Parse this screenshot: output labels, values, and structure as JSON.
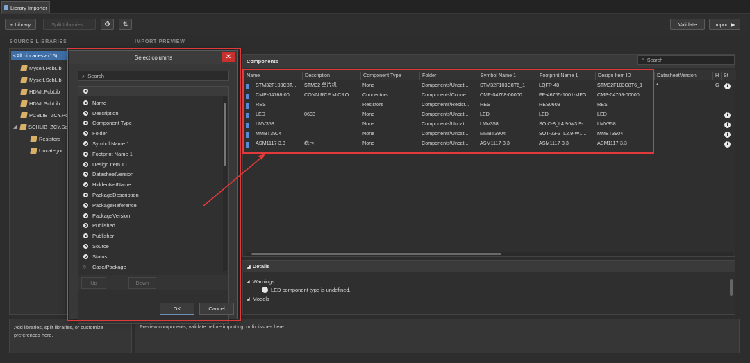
{
  "window": {
    "tab_title": "Library Importer"
  },
  "toolbar": {
    "add_library": "+ Library",
    "split_libraries": "Split Libraries...",
    "validate": "Validate",
    "import": "Import"
  },
  "source_libraries": {
    "title": "SOURCE LIBRARIES",
    "items": [
      {
        "label": "<All Libraries> (16)",
        "selected": true
      },
      {
        "label": "Myself.PcbLib"
      },
      {
        "label": "Myself.SchLib"
      },
      {
        "label": "HDMI.PcbLib"
      },
      {
        "label": "HDMI.SchLib"
      },
      {
        "label": "PCBLIB_ZCY.Pc"
      },
      {
        "label": "SCHLIB_ZCY.Sc"
      },
      {
        "label": "Resistors"
      },
      {
        "label": "Uncategor"
      }
    ]
  },
  "import_preview": {
    "title": "IMPORT PREVIEW",
    "components_label": "Components",
    "search_placeholder": "Search",
    "columns": [
      "Name",
      "Description",
      "Component Type",
      "Folder",
      "Symbol Name 1",
      "Footprint Name 1",
      "Design Item ID",
      "DatasheetVersion",
      "H",
      "St"
    ],
    "rows": [
      [
        "STM32F103C8T...",
        "STM32 单片机",
        "None",
        "Components\\Uncat...",
        "STM32F103C8T6_1",
        "LQFP-48",
        "STM32F103C8T6_1",
        "*",
        "G",
        "i"
      ],
      [
        "CMP-04768-00...",
        "CONN RCP MICRO...",
        "Connectors",
        "Components\\Conne...",
        "CMP-04768-00000...",
        "FP-46765-1001-MFG",
        "CMP-04768-00000...",
        "",
        "",
        ""
      ],
      [
        "RES",
        "",
        "Resistors",
        "Components\\Resist...",
        "RES",
        "RES0603",
        "RES",
        "",
        "",
        ""
      ],
      [
        "LED",
        "0603",
        "None",
        "Components\\Uncat...",
        "LED",
        "LED",
        "LED",
        "",
        "",
        "i"
      ],
      [
        "LMV358",
        "",
        "None",
        "Components\\Uncat...",
        "LMV358",
        "SOIC-8_L4.9-W3.9-...",
        "LMV358",
        "",
        "",
        "i"
      ],
      [
        "MMBT3904",
        "",
        "None",
        "Components\\Uncat...",
        "MMBT3904",
        "SOT-23-3_L2.9-W1...",
        "MMBT3904",
        "",
        "",
        "i"
      ],
      [
        "ASM1117-3.3",
        "稳压",
        "None",
        "Components\\Uncat...",
        "ASM1117-3.3",
        "ASM1117-3.3",
        "ASM1117-3.3",
        "",
        "",
        "i"
      ]
    ]
  },
  "details": {
    "title": "Details",
    "warnings_label": "Warnings",
    "warning_text": "LED component type is undefined.",
    "models_label": "Models"
  },
  "footer": {
    "left_text": "Add libraries, split libraries, or customize preferences here.",
    "right_text": "Preview components, validate before importing, or fix issues here."
  },
  "dialog": {
    "title": "Select columns",
    "search_placeholder": "Search",
    "columns": [
      {
        "label": "Name",
        "visible": true
      },
      {
        "label": "Description",
        "visible": true
      },
      {
        "label": "Component Type",
        "visible": true
      },
      {
        "label": "Folder",
        "visible": true
      },
      {
        "label": "Symbol Name 1",
        "visible": true
      },
      {
        "label": "Footprint Name 1",
        "visible": true
      },
      {
        "label": "Design Item ID",
        "visible": true
      },
      {
        "label": "DatasheetVersion",
        "visible": true
      },
      {
        "label": "HiddenNetName",
        "visible": true
      },
      {
        "label": "PackageDescription",
        "visible": true
      },
      {
        "label": "PackageReference",
        "visible": true
      },
      {
        "label": "PackageVersion",
        "visible": true
      },
      {
        "label": "Published",
        "visible": true
      },
      {
        "label": "Publisher",
        "visible": true
      },
      {
        "label": "Source",
        "visible": true
      },
      {
        "label": "Status",
        "visible": true
      },
      {
        "label": "Case/Package",
        "visible": false
      }
    ],
    "up": "Up",
    "down": "Down",
    "ok": "OK",
    "cancel": "Cancel"
  },
  "colors": {
    "accent": "#3e6fa8",
    "highlight": "#e23a3a",
    "close": "#c8302e"
  }
}
